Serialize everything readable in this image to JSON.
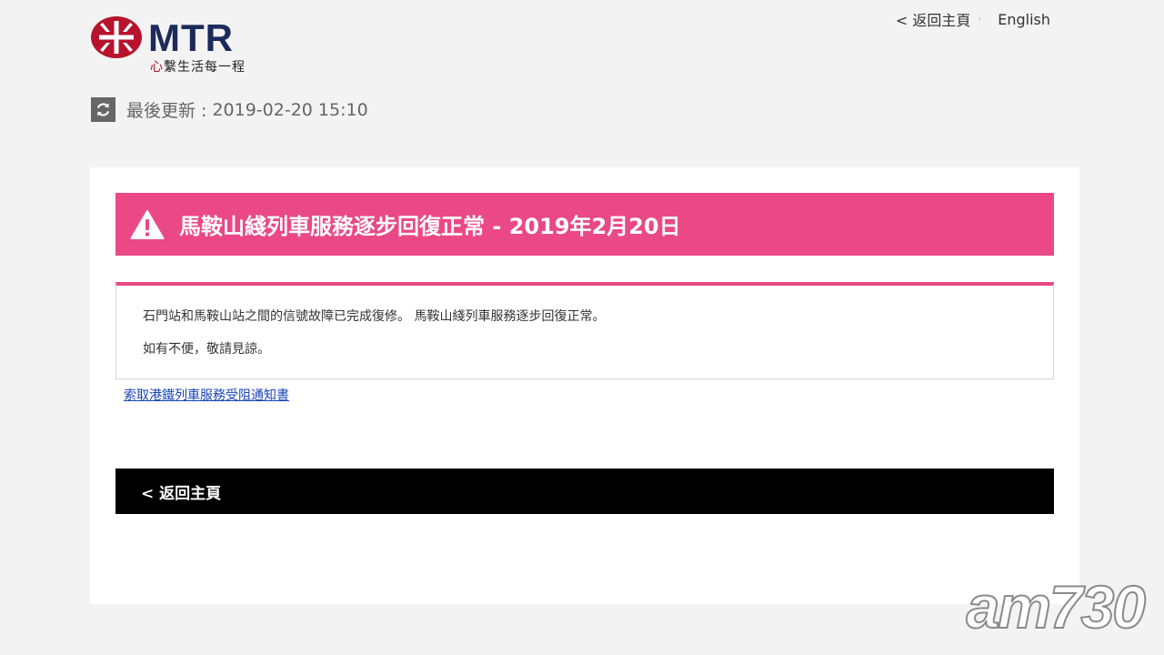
{
  "header": {
    "brand_name": "MTR",
    "tagline_accent": "心",
    "tagline_rest": "繫生活每一程",
    "nav": {
      "home_label": "< 返回主頁",
      "separator": "·",
      "language_label": "English"
    }
  },
  "status": {
    "updated_label": "最後更新 :",
    "updated_time": "2019-02-20 15:10"
  },
  "alert": {
    "title": "馬鞍山綫列車服務逐步回復正常 - 2019年2月20日",
    "messages": [
      "石門站和馬鞍山站之間的信號故障已完成復修。 馬鞍山綫列車服務逐步回復正常。",
      "如有不便，敬請見諒。"
    ],
    "notice_link": "索取港鐵列車服務受阻通知書"
  },
  "footer": {
    "back_label": "< 返回主頁"
  },
  "watermark": {
    "text": "am730"
  },
  "colors": {
    "brand_navy": "#1c2a5c",
    "brand_red": "#b7132d",
    "alert_pink": "#ea4886",
    "link_blue": "#1a44b8",
    "background": "#f3f3f3"
  },
  "icons": {
    "logo": "mtr-logo-icon",
    "refresh": "refresh-icon",
    "warning": "warning-triangle-icon"
  }
}
